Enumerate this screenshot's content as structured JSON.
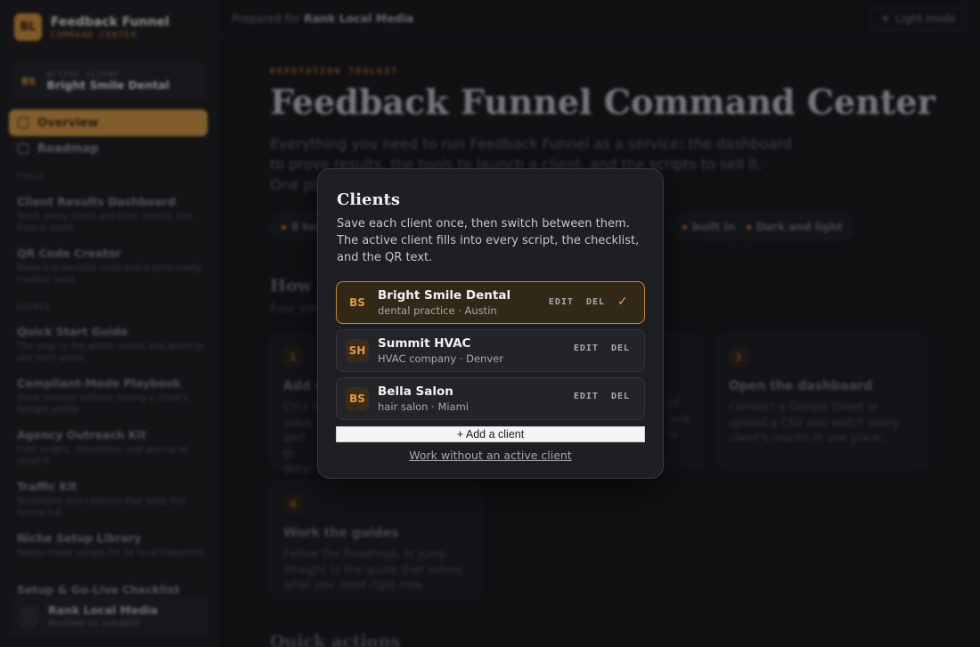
{
  "sidebar": {
    "brand_logo": "BL",
    "brand_name": "Feedback Funnel",
    "brand_sub": "COMMAND CENTER",
    "active_client": {
      "label": "ACTIVE CLIENT",
      "badge": "BS",
      "name": "Bright Smile Dental"
    },
    "nav": [
      {
        "label": "Overview",
        "icon": "grid-icon",
        "active": true
      },
      {
        "label": "Roadmap",
        "icon": "list-icon",
        "active": false
      }
    ],
    "tools_label": "TOOLS",
    "tools": [
      {
        "title": "Client Results Dashboard",
        "desc": "Track every client and their results, live from a sheet"
      },
      {
        "title": "QR Code Creator",
        "desc": "Make a scannable code and a print-ready counter card"
      }
    ],
    "guides_label": "GUIDES",
    "guides": [
      {
        "title": "Quick Start Guide",
        "desc": "The map to the whole toolkit and when to use each piece"
      },
      {
        "title": "Compliant-Mode Playbook",
        "desc": "Grow reviews without risking a client's Google profile"
      },
      {
        "title": "Agency Outreach Kit",
        "desc": "Cold scripts, objections, and pricing to resell it"
      },
      {
        "title": "Traffic Kit",
        "desc": "Templates and cadence that keep the funnel full"
      },
      {
        "title": "Niche Setup Library",
        "desc": "Ready-made setups for 50 local industries"
      },
      {
        "title": "Setup & Go-Live Checklist",
        "desc": ""
      }
    ],
    "agency": {
      "name": "Rank Local Media",
      "sub": "Reviews on autopilot"
    }
  },
  "topbar": {
    "prepared_prefix": "Prepared for",
    "prepared_name": "Rank Local Media",
    "light_mode": "Light mode",
    "light_icon": "sun-icon"
  },
  "main": {
    "eyebrow": "REPUTATION TOOLKIT",
    "title": "Feedback Funnel Command Center",
    "desc": "Everything you need to run Feedback Funnel as a service: the dashboard to prove results, the tools to launch a client, and the scripts to sell it. One place, built to",
    "pills": [
      "8 tools",
      "built in",
      "Dark and light"
    ],
    "how_title": "How to",
    "how_sub": "Four ste",
    "steps": [
      {
        "num": "1",
        "title": "Add c",
        "desc": "Click t sideb and th detai"
      },
      {
        "num": "3",
        "title": "Open the dashboard",
        "desc": "Connect a Google Sheet or upload a CSV and watch every client's results in one place."
      },
      {
        "num": "4",
        "title": "Work the guides",
        "desc": "Follow the Roadmap, or jump straight to the guide that solves what you need right now."
      }
    ],
    "partial_step_text": [
      "of",
      "and",
      "is"
    ],
    "quick_actions": "Quick actions"
  },
  "modal": {
    "title": "Clients",
    "desc": "Save each client once, then switch between them. The active client fills into every script, the checklist, and the QR text.",
    "edit_label": "EDIT",
    "del_label": "DEL",
    "clients": [
      {
        "badge": "BS",
        "name": "Bright Smile Dental",
        "sub": "dental practice · Austin",
        "active": true
      },
      {
        "badge": "SH",
        "name": "Summit HVAC",
        "sub": "HVAC company · Denver",
        "active": false
      },
      {
        "badge": "BS",
        "name": "Bella Salon",
        "sub": "hair salon · Miami",
        "active": false
      }
    ],
    "add_client": "+ Add a client",
    "work_without": "Work without an active client"
  },
  "colors": {
    "accent": "#d89a43",
    "modal_bg": "#1e1f22",
    "active_row_border": "#c48633"
  }
}
